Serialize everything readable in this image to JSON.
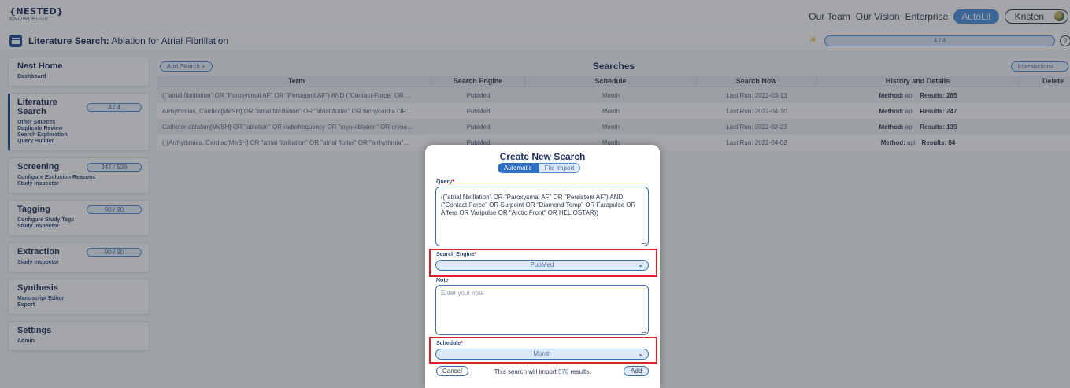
{
  "app": {
    "logo_line1": "{NESTED}",
    "logo_line2": "KNOWLEDGE",
    "nav": [
      "Our Team",
      "Our Vision",
      "Enterprise"
    ],
    "autolit": "AutoLit",
    "user": "Kristen"
  },
  "subbar": {
    "title_bold": "Literature Search:",
    "title_rest": " Ablation for Atrial Fibrillation",
    "progress": "4 / 4",
    "help": "?"
  },
  "sidebar": [
    {
      "title": "Nest Home",
      "badge": "",
      "links": [
        "Dashboard"
      ]
    },
    {
      "title": "Literature Search",
      "badge": "4 / 4",
      "links": [
        "Other Sources",
        "Duplicate Review",
        "Search Exploration",
        "Query Builder"
      ]
    },
    {
      "title": "Screening",
      "badge": "347 / 536",
      "links": [
        "Configure Exclusion Reasons",
        "Study Inspector"
      ]
    },
    {
      "title": "Tagging",
      "badge": "90 / 90",
      "links": [
        "Configure Study Tags",
        "Study Inspector"
      ]
    },
    {
      "title": "Extraction",
      "badge": "90 / 90",
      "links": [
        "Study Inspector"
      ]
    },
    {
      "title": "Synthesis",
      "badge": "",
      "links": [
        "Manuscript Editor",
        "Export"
      ]
    },
    {
      "title": "Settings",
      "badge": "",
      "links": [
        "Admin"
      ]
    }
  ],
  "main": {
    "add_search": "Add Search  +",
    "title": "Searches",
    "intersections": "Intersections",
    "columns": [
      "Term",
      "Search Engine",
      "Schedule",
      "Search Now",
      "History and Details",
      "Delete"
    ],
    "rows": [
      {
        "term": "((\"atrial fibrillation\" OR \"Paroxysmal AF\" OR \"Persistent AF\") AND (\"Contact-Force\" OR ...",
        "engine": "PubMed",
        "schedule": "Month",
        "last_run": "Last Run: 2022-03-13",
        "method": "api",
        "results": "285"
      },
      {
        "term": "Arrhythmias, Cardiac[MeSH] OR \"atrial fibrillation\" OR \"atrial flutter\" OR tachycardia OR...",
        "engine": "PubMed",
        "schedule": "Month",
        "last_run": "Last Run: 2022-04-10",
        "method": "api",
        "results": "247"
      },
      {
        "term": "Catheter ablation[MeSH] OR \"ablation\" OR radiofrequency OR \"cryo-ablation\" OR cryoa...",
        "engine": "PubMed",
        "schedule": "Month",
        "last_run": "Last Run: 2022-03-23",
        "method": "api",
        "results": "139"
      },
      {
        "term": "(((Arrhythmias, Cardiac[MeSH] OR \"atrial fibrillation\" OR \"atrial flutter\" OR \"arrhythmia\"...",
        "engine": "PubMed",
        "schedule": "Month",
        "last_run": "Last Run: 2022-04-02",
        "method": "api",
        "results": "84"
      }
    ],
    "method_label": "Method:",
    "results_label": "Results:"
  },
  "modal": {
    "title": "Create New Search",
    "tab_automatic": "Automatic",
    "tab_file_import": "File Import",
    "query_label": "Query",
    "query_value": "((\"atrial fibrillation\" OR \"Paroxysmal AF\" OR \"Persistent AF\") AND (\"Contact-Force\" OR Surpoint OR \"Diamond Temp\" OR Farapulse OR Affera OR Varipulse OR \"Arctic Front\" OR HELIOSTAR))",
    "engine_label": "Search Engine",
    "engine_value": "PubMed",
    "note_label": "Note",
    "note_placeholder": "Enter your note",
    "schedule_label": "Schedule",
    "schedule_value": "Month",
    "required_mark": "*",
    "cancel": "Cancel",
    "import_pre": "This search will import ",
    "import_count": "576",
    "import_post": " results.",
    "add": "Add"
  },
  "colors": {
    "accent": "#4b8fe0",
    "brand_dark": "#1c2f5b",
    "highlight": "#e0202a"
  }
}
